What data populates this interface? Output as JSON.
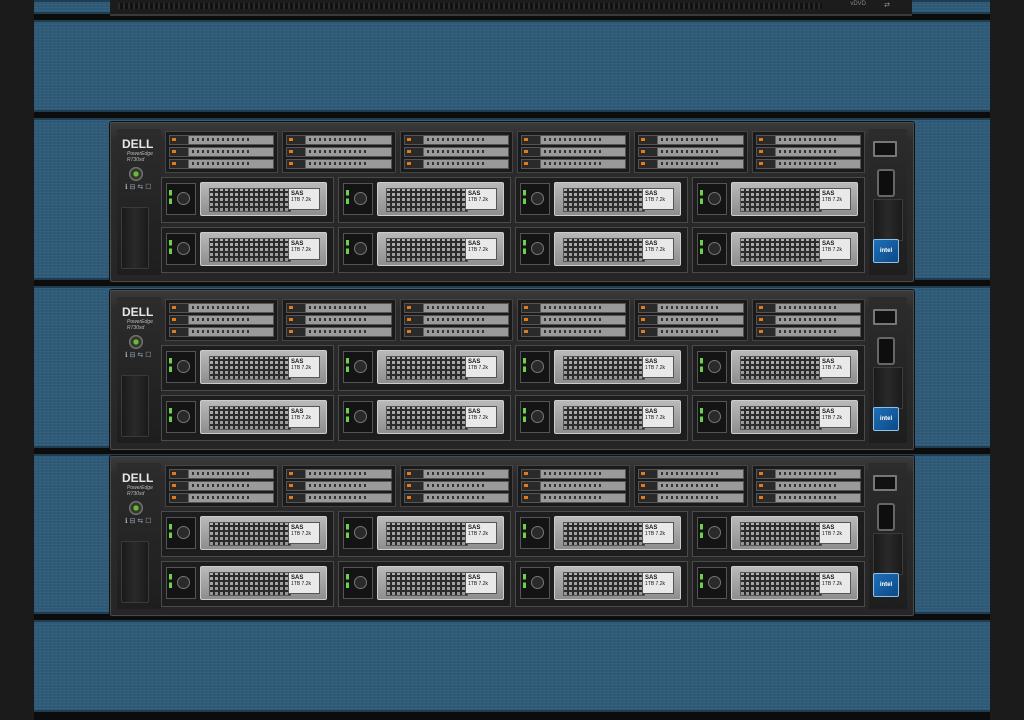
{
  "rack": {
    "background_color": "#2f5b78",
    "rail_color": "#1b1b1b"
  },
  "top_partial_server": {
    "label_left": "vDVD",
    "usb_symbol": "⇄"
  },
  "servers": [
    {
      "brand": "DELL",
      "model_line1": "PowerEdge",
      "model_line2": "R730xd",
      "badge": "intel",
      "drives": [
        {
          "label": "SAS",
          "spec": "1TB 7.2k"
        },
        {
          "label": "SAS",
          "spec": "1TB 7.2k"
        },
        {
          "label": "SAS",
          "spec": "1TB 7.2k"
        },
        {
          "label": "SAS",
          "spec": "1TB 7.2k"
        },
        {
          "label": "SAS",
          "spec": "1TB 7.2k"
        },
        {
          "label": "SAS",
          "spec": "1TB 7.2k"
        },
        {
          "label": "SAS",
          "spec": "1TB 7.2k"
        },
        {
          "label": "SAS",
          "spec": "1TB 7.2k"
        }
      ]
    },
    {
      "brand": "DELL",
      "model_line1": "PowerEdge",
      "model_line2": "R730xd",
      "badge": "intel",
      "drives": [
        {
          "label": "SAS",
          "spec": "1TB 7.2k"
        },
        {
          "label": "SAS",
          "spec": "1TB 7.2k"
        },
        {
          "label": "SAS",
          "spec": "1TB 7.2k"
        },
        {
          "label": "SAS",
          "spec": "1TB 7.2k"
        },
        {
          "label": "SAS",
          "spec": "1TB 7.2k"
        },
        {
          "label": "SAS",
          "spec": "1TB 7.2k"
        },
        {
          "label": "SAS",
          "spec": "1TB 7.2k"
        },
        {
          "label": "SAS",
          "spec": "1TB 7.2k"
        }
      ]
    },
    {
      "brand": "DELL",
      "model_line1": "PowerEdge",
      "model_line2": "R730xd",
      "badge": "intel",
      "drives": [
        {
          "label": "SAS",
          "spec": "1TB 7.2k"
        },
        {
          "label": "SAS",
          "spec": "1TB 7.2k"
        },
        {
          "label": "SAS",
          "spec": "1TB 7.2k"
        },
        {
          "label": "SAS",
          "spec": "1TB 7.2k"
        },
        {
          "label": "SAS",
          "spec": "1TB 7.2k"
        },
        {
          "label": "SAS",
          "spec": "1TB 7.2k"
        },
        {
          "label": "SAS",
          "spec": "1TB 7.2k"
        },
        {
          "label": "SAS",
          "spec": "1TB 7.2k"
        }
      ]
    }
  ],
  "icons": {
    "status_icons": "ℹ ⊟ ⇆ ☐",
    "power": "power-button-icon"
  }
}
